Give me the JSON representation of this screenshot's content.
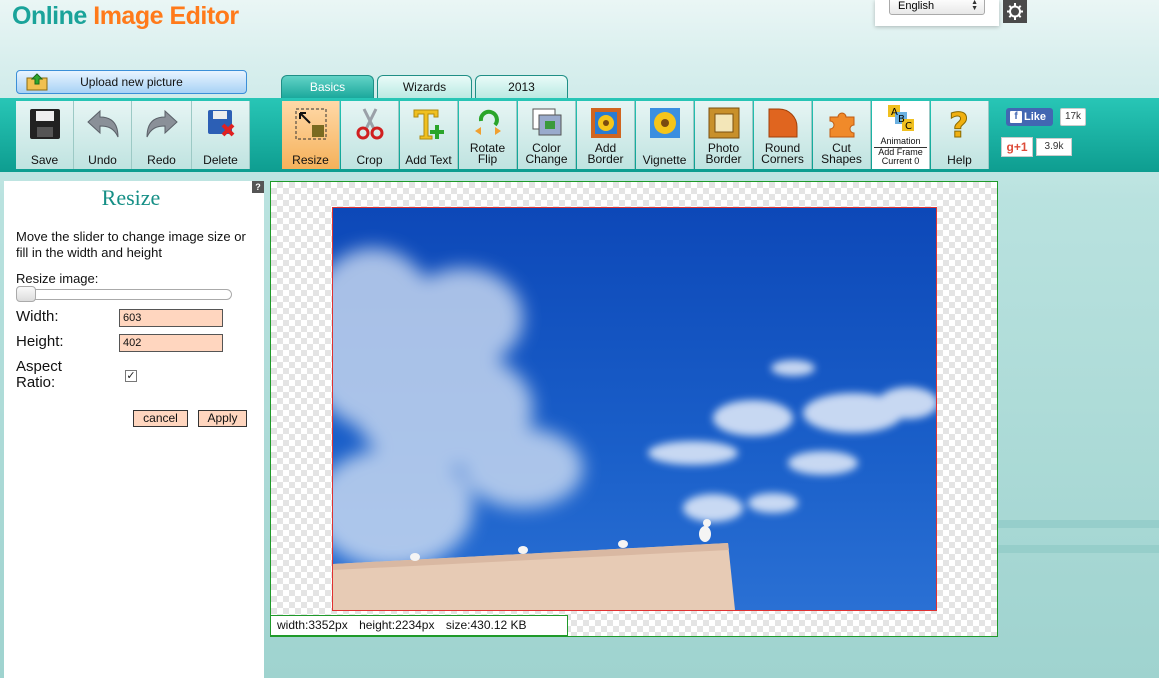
{
  "header": {
    "logo_part1": "Online",
    "logo_part2": "Image Editor",
    "language": "English"
  },
  "upload": {
    "label": "Upload new picture"
  },
  "tabs": [
    {
      "label": "Basics",
      "active": true
    },
    {
      "label": "Wizards"
    },
    {
      "label": "2013"
    }
  ],
  "toolbar": {
    "save": "Save",
    "undo": "Undo",
    "redo": "Redo",
    "delete": "Delete",
    "resize": "Resize",
    "crop": "Crop",
    "add_text": "Add Text",
    "rotate_1": "Rotate",
    "rotate_2": "Flip",
    "color_1": "Color",
    "color_2": "Change",
    "border_1": "Add",
    "border_2": "Border",
    "vignette": "Vignette",
    "photo_border_1": "Photo",
    "photo_border_2": "Border",
    "round_1": "Round",
    "round_2": "Corners",
    "cut_1": "Cut",
    "cut_2": "Shapes",
    "animation_1": "Animation",
    "animation_2": "Add Frame",
    "animation_3": "Current 0",
    "help": "Help"
  },
  "social": {
    "fb_label": "Like",
    "fb_count": "17k",
    "gplus_label": "g+1",
    "gplus_count": "3.9k"
  },
  "panel": {
    "help": "?",
    "title": "Resize",
    "description": "Move the slider to change image size or fill in the width and height",
    "resize_label": "Resize image:",
    "slider_value": 0,
    "width_label": "Width:",
    "width_value": "603",
    "height_label": "Height:",
    "height_value": "402",
    "aspect_label_1": "Aspect",
    "aspect_label_2": "Ratio:",
    "aspect_checked": true,
    "cancel": "cancel",
    "apply": "Apply"
  },
  "info": {
    "width": "width:3352px",
    "height": "height:2234px",
    "size": "size:430.12 KB"
  },
  "colors": {
    "accent": "#18a69a",
    "logo_teal": "#1aa39a",
    "logo_orange": "#ff7a1a",
    "active_tool": "#f5b15a"
  }
}
